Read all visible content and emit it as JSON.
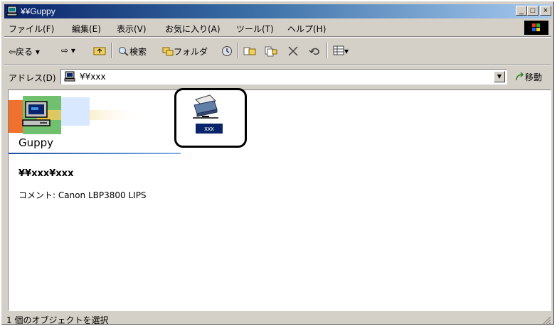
{
  "window": {
    "title": "¥¥Guppy",
    "controls": {
      "minimize": "_",
      "maximize": "□",
      "close": "×"
    }
  },
  "menubar": {
    "items": [
      {
        "label": "ファイル(F)"
      },
      {
        "label": "編集(E)"
      },
      {
        "label": "表示(V)"
      },
      {
        "label": "お気に入り(A)"
      },
      {
        "label": "ツール(T)"
      },
      {
        "label": "ヘルプ(H)"
      }
    ]
  },
  "toolbar": {
    "back": "⇦戻る ▾",
    "forward": "⇨ ▾",
    "up": "⤒",
    "search": "検索",
    "folders": "フォルダ",
    "views": "▾"
  },
  "address": {
    "label": "アドレス(D)",
    "value": "¥¥xxx",
    "go": "移動"
  },
  "content": {
    "banner_title": "Guppy",
    "share_path": "¥¥xxx¥xxx",
    "comment": "コメント: Canon LBP3800 LIPS",
    "printer_item_label": "xxx"
  },
  "status": {
    "text": "1 個のオブジェクトを選択"
  },
  "colors": {
    "titlebar_start": "#0a246a",
    "titlebar_end": "#a6caf0",
    "selection": "#0a246a",
    "window_face": "#d4d0c8"
  },
  "icons": [
    "computer-icon",
    "printer-share-icon",
    "search-icon",
    "folders-icon",
    "history-icon",
    "move-to-icon",
    "copy-to-icon",
    "delete-icon",
    "undo-icon",
    "views-icon",
    "go-icon",
    "windows-flag-icon"
  ]
}
